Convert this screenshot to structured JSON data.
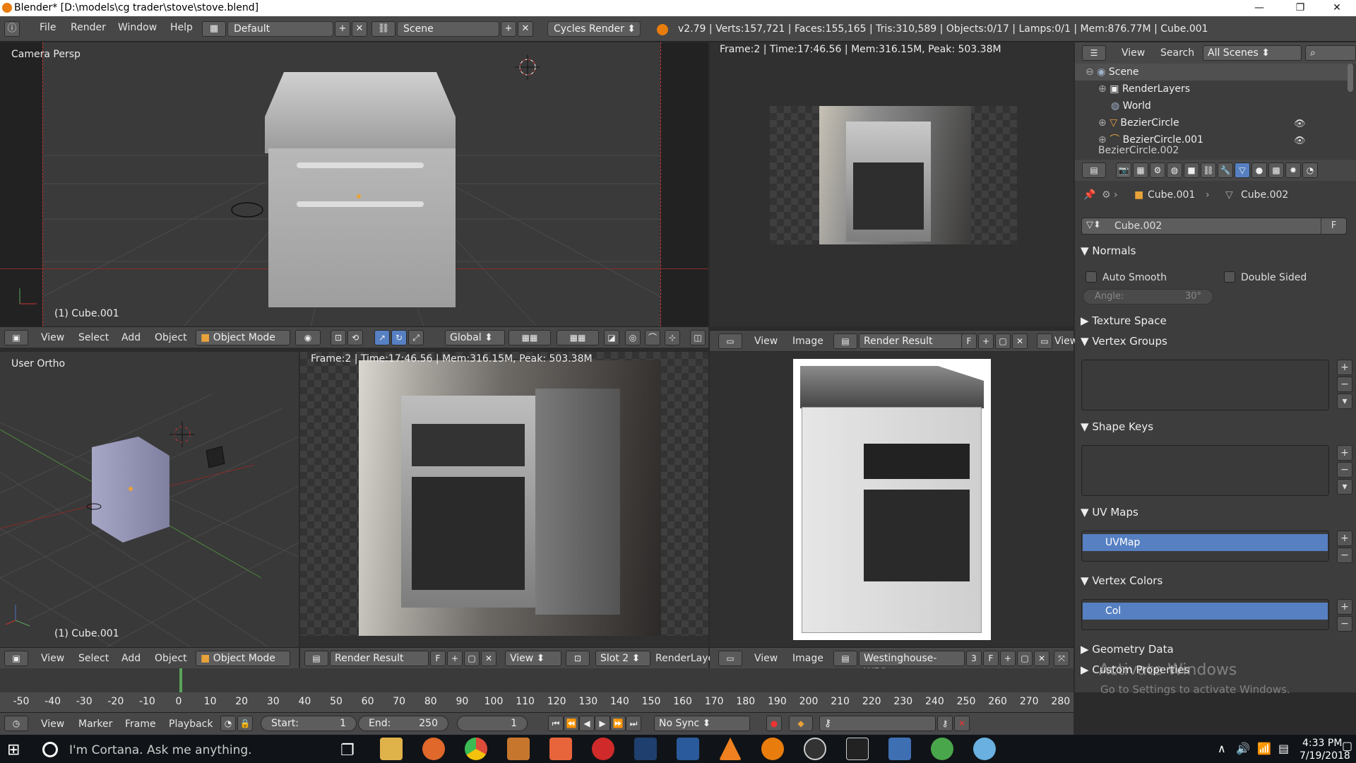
{
  "window": {
    "title": "Blender* [D:\\models\\cg trader\\stove\\stove.blend]",
    "controls": [
      "—",
      "❐",
      "✕"
    ]
  },
  "info_header": {
    "menus": [
      "File",
      "Render",
      "Window",
      "Help"
    ],
    "layout": "Default",
    "scene": "Scene",
    "engine": "Cycles Render",
    "stats": "v2.79 | Verts:157,721 | Faces:155,165 | Tris:310,589 | Objects:0/17 | Lamps:0/1 | Mem:876.77M | Cube.001"
  },
  "viewport_top_left": {
    "label": "Camera Persp",
    "object": "(1) Cube.001",
    "header": {
      "menus": [
        "View",
        "Select",
        "Add",
        "Object"
      ],
      "mode": "Object Mode",
      "orientation": "Global"
    }
  },
  "viewport_bottom_left": {
    "label": "User Ortho",
    "object": "(1) Cube.001",
    "header": {
      "menus": [
        "View",
        "Select",
        "Add",
        "Object"
      ],
      "mode": "Object Mode"
    }
  },
  "image_top_right": {
    "info": "Frame:2 | Time:17:46.56 | Mem:316.15M, Peak: 503.38M",
    "header": {
      "menus": [
        "View",
        "Image"
      ],
      "image": "Render Result",
      "f": "F",
      "extra_menu": "View"
    }
  },
  "image_bottom_middle": {
    "info": "Frame:2 | Time:17:46.56 | Mem:316.15M, Peak: 503.38M",
    "header": {
      "image": "Render Result",
      "f": "F",
      "menu": "View",
      "slot": "Slot 2",
      "layer": "RenderLayer"
    }
  },
  "image_bottom_right": {
    "header": {
      "menus": [
        "View",
        "Image"
      ],
      "image": "Westinghouse-WFG...",
      "users": "3",
      "f": "F"
    }
  },
  "outliner": {
    "menus": [
      "View",
      "Search"
    ],
    "filter": "All Scenes",
    "items": [
      "Scene",
      "RenderLayers",
      "World",
      "BezierCircle",
      "BezierCircle.001",
      "BezierCircle.002"
    ]
  },
  "properties": {
    "breadcrumb": [
      "Cube.001",
      "Cube.002"
    ],
    "datablock": "Cube.002",
    "fake_user": "F",
    "normals": {
      "title": "Normals",
      "auto_smooth": "Auto Smooth",
      "double_sided": "Double Sided",
      "angle_label": "Angle:",
      "angle_value": "30°"
    },
    "texture_space": "Texture Space",
    "vertex_groups": "Vertex Groups",
    "shape_keys": "Shape Keys",
    "uv_maps": {
      "title": "UV Maps",
      "item": "UVMap"
    },
    "vertex_colors": {
      "title": "Vertex Colors",
      "item": "Col"
    },
    "geometry_data": "Geometry Data",
    "custom_properties": "Custom Properties"
  },
  "watermark": {
    "line1": "Activate Windows",
    "line2": "Go to Settings to activate Windows."
  },
  "timeline": {
    "ticks": [
      -50,
      -40,
      -30,
      -20,
      -10,
      0,
      10,
      20,
      30,
      40,
      50,
      60,
      70,
      80,
      90,
      100,
      110,
      120,
      130,
      140,
      150,
      160,
      170,
      180,
      190,
      200,
      210,
      220,
      230,
      240,
      250,
      260,
      270,
      280
    ],
    "current_frame": 2,
    "menus": [
      "View",
      "Marker",
      "Frame",
      "Playback"
    ],
    "start_label": "Start:",
    "start": "1",
    "end_label": "End:",
    "end": "250",
    "frame": "1",
    "sync": "No Sync"
  },
  "taskbar": {
    "cortana": "I'm Cortana. Ask me anything.",
    "time": "4:33 PM",
    "date": "7/19/2018"
  },
  "colors": {
    "selection": "#5680c2",
    "blender_orange": "#e87d0d",
    "header": "#474747"
  }
}
